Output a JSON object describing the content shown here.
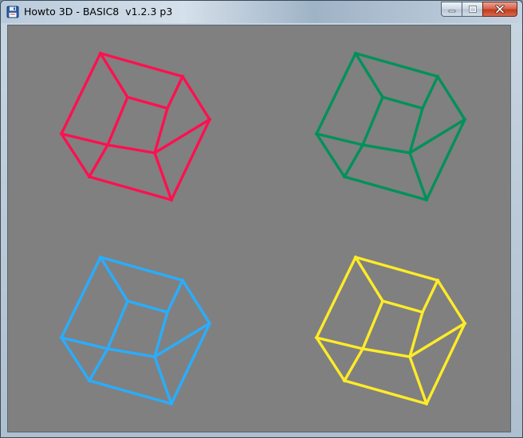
{
  "window": {
    "title": "Howto 3D - BASIC8  v1.2.3 p3",
    "app_icon": "floppy-disk-icon",
    "buttons": {
      "minimize_icon": "minimize-icon",
      "maximize_icon": "maximize-icon",
      "close_icon": "close-icon"
    }
  },
  "canvas": {
    "background": "#808080",
    "cubes": [
      {
        "name": "red",
        "color": "#ff1050"
      },
      {
        "name": "green",
        "color": "#00915a"
      },
      {
        "name": "blue",
        "color": "#29adff"
      },
      {
        "name": "yellow",
        "color": "#ffec27"
      }
    ]
  }
}
